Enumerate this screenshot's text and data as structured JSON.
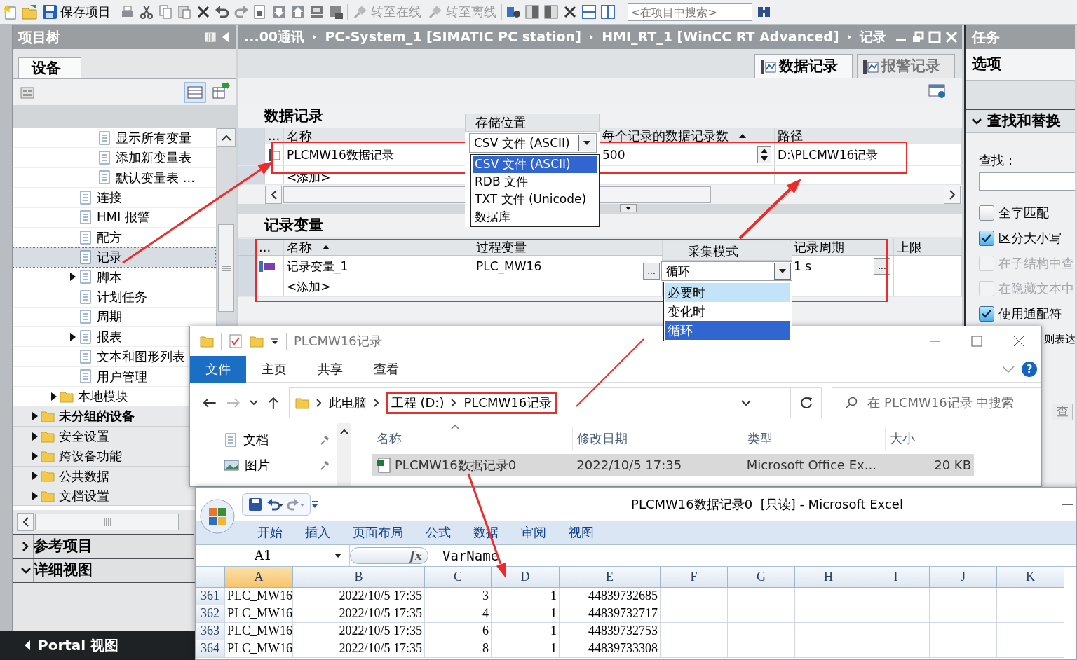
{
  "toolbar": {
    "save_label": "保存项目",
    "go_online": "转至在线",
    "go_offline": "转至离线",
    "search": {
      "placeholder": "<在项目中搜索>"
    }
  },
  "project_tree": {
    "title": "项目树",
    "tab": "设备",
    "items": [
      {
        "children": [
          {
            "children": [
              {
                "children": [
                  {
                    "label": "显示所有变量",
                    "collapsed": false,
                    "selected": false,
                    "bold": false
                  },
                  {
                    "label": "添加新变量表",
                    "collapsed": false,
                    "selected": false,
                    "bold": false
                  },
                  {
                    "label": "默认变量表 ...",
                    "collapsed": false,
                    "selected": false,
                    "bold": false
                  }
                ]
              },
              {
                "label": "连接",
                "collapsed": false,
                "selected": false,
                "bold": false
              },
              {
                "label": "HMI 报警",
                "collapsed": false,
                "selected": false,
                "bold": false
              },
              {
                "label": "配方",
                "collapsed": false,
                "selected": false,
                "bold": false
              },
              {
                "label": "记录",
                "collapsed": false,
                "selected": true,
                "bold": false
              },
              {
                "label": "脚本",
                "collapsed": true,
                "selected": false,
                "bold": false
              },
              {
                "label": "计划任务",
                "collapsed": false,
                "selected": false,
                "bold": false
              },
              {
                "label": "周期",
                "collapsed": false,
                "selected": false,
                "bold": false
              },
              {
                "label": "报表",
                "collapsed": true,
                "selected": false,
                "bold": false
              },
              {
                "label": "文本和图形列表",
                "collapsed": false,
                "selected": false,
                "bold": false
              },
              {
                "label": "用户管理",
                "collapsed": false,
                "selected": false,
                "bold": false
              }
            ]
          },
          {
            "label": "本地模块",
            "collapsed": true,
            "selected": false,
            "bold": false
          }
        ]
      },
      {
        "label": "未分组的设备",
        "collapsed": true,
        "selected": false,
        "bold": true
      },
      {
        "label": "安全设置",
        "collapsed": true,
        "selected": false,
        "bold": false
      },
      {
        "label": "跨设备功能",
        "collapsed": true,
        "selected": false,
        "bold": false
      },
      {
        "label": "公共数据",
        "collapsed": true,
        "selected": false,
        "bold": false
      },
      {
        "label": "文档设置",
        "collapsed": true,
        "selected": false,
        "bold": false
      }
    ]
  },
  "side_panels": [
    {
      "label": "参考项目",
      "expanded": false
    },
    {
      "label": "详细视图",
      "expanded": true
    }
  ],
  "portal_view": "Portal 视图",
  "editor": {
    "breadcrumb": [
      "...00通讯",
      "PC-System_1 [SIMATIC PC station]",
      "HMI_RT_1 [WinCC RT Advanced]",
      "记录"
    ],
    "tabs": [
      {
        "label": "数据记录",
        "selected": true
      },
      {
        "label": "报警记录",
        "selected": false
      }
    ],
    "data_logs": {
      "title": "数据记录",
      "columns": [
        {
          "label": "...",
          "sorted": false
        },
        {
          "label": "名称",
          "sorted": false
        },
        {
          "label": "每个记录的数据记录数",
          "sorted": true
        },
        {
          "label": "路径",
          "sorted": false
        }
      ],
      "rows": [
        {
          "name": "PLCMW16数据记录",
          "records_per_log": "500",
          "path": "D:\\PLCMW16记录"
        }
      ],
      "add_row": "<添加>"
    },
    "storage_popup": {
      "header": "存储位置",
      "value": "CSV 文件 (ASCII)",
      "options": [
        {
          "label": "CSV 文件 (ASCII)",
          "selected": true
        },
        {
          "label": "RDB 文件",
          "selected": false
        },
        {
          "label": "TXT 文件 (Unicode)",
          "selected": false
        },
        {
          "label": "数据库",
          "selected": false
        }
      ]
    },
    "logging_tags": {
      "title": "记录变量",
      "columns": [
        {
          "label": "...",
          "sorted": false
        },
        {
          "label": "名称",
          "sorted": true
        },
        {
          "label": "过程变量",
          "sorted": false
        },
        {
          "label": "记录周期",
          "sorted": false
        },
        {
          "label": "上限",
          "sorted": false
        }
      ],
      "rows": [
        {
          "name": "记录变量_1",
          "process_tag": "PLC_MW16",
          "cycle": "1 s",
          "browse_button": "..."
        }
      ],
      "add_row": "<添加>"
    },
    "mode_popup": {
      "header": "采集模式",
      "browse_button": "...",
      "value": "循环",
      "options": [
        {
          "label": "必要时",
          "selected": false,
          "hovered": true
        },
        {
          "label": "变化时",
          "selected": false,
          "hovered": false
        },
        {
          "label": "循环",
          "selected": true,
          "hovered": false
        }
      ]
    }
  },
  "tasks": {
    "title": "任务",
    "section": "选项",
    "find_replace": {
      "title": "查找和替换",
      "expanded": true,
      "find_label": "查找：",
      "options": [
        {
          "label": "全字匹配",
          "checked": false,
          "disabled": false
        },
        {
          "label": "区分大小写",
          "checked": true,
          "disabled": false
        },
        {
          "label": "在子结构中查",
          "checked": false,
          "disabled": true
        },
        {
          "label": "在隐藏文本中",
          "checked": false,
          "disabled": true
        },
        {
          "label": "使用通配符",
          "checked": true,
          "disabled": false
        }
      ],
      "partial_label": "则表达",
      "find_button": "查"
    }
  },
  "explorer": {
    "title": "PLCMW16记录",
    "ribbon_tabs": [
      {
        "label": "文件",
        "selected": true
      },
      {
        "label": "主页",
        "selected": false
      },
      {
        "label": "共享",
        "selected": false
      },
      {
        "label": "查看",
        "selected": false
      }
    ],
    "help_button": "?",
    "address": [
      "此电脑",
      "工程 (D:)",
      "PLCMW16记录"
    ],
    "search": {
      "placeholder": "在 PLCMW16记录 中搜索"
    },
    "nav_items": [
      {
        "label": "文档",
        "pinned": true
      },
      {
        "label": "图片",
        "pinned": true
      }
    ],
    "columns": [
      "名称",
      "修改日期",
      "类型",
      "大小"
    ],
    "files": [
      {
        "name": "PLCMW16数据记录0",
        "modified": "2022/10/5 17:35",
        "type": "Microsoft Office Ex...",
        "size": "20 KB",
        "selected": true
      }
    ]
  },
  "excel": {
    "title": "PLCMW16数据记录0  [只读] - Microsoft Excel",
    "ribbon_tabs": [
      "开始",
      "插入",
      "页面布局",
      "公式",
      "数据",
      "审阅",
      "视图"
    ],
    "name_box": "A1",
    "function_label": "fx",
    "formula": "VarName",
    "columns": [
      {
        "label": "A",
        "selected": true
      },
      {
        "label": "B",
        "selected": false
      },
      {
        "label": "C",
        "selected": false
      },
      {
        "label": "D",
        "selected": false
      },
      {
        "label": "E",
        "selected": false
      },
      {
        "label": "F",
        "selected": false
      },
      {
        "label": "G",
        "selected": false
      },
      {
        "label": "H",
        "selected": false
      },
      {
        "label": "I",
        "selected": false
      },
      {
        "label": "J",
        "selected": false
      },
      {
        "label": "K",
        "selected": false
      }
    ],
    "rows": [
      {
        "number": "361",
        "cells": [
          "PLC_MW16",
          "2022/10/5 17:35",
          "3",
          "1",
          "44839732685"
        ]
      },
      {
        "number": "362",
        "cells": [
          "PLC_MW16",
          "2022/10/5 17:35",
          "4",
          "1",
          "44839732717"
        ]
      },
      {
        "number": "363",
        "cells": [
          "PLC_MW16",
          "2022/10/5 17:35",
          "6",
          "1",
          "44839732753"
        ]
      },
      {
        "number": "364",
        "cells": [
          "PLC_MW16",
          "2022/10/5 17:35",
          "8",
          "1",
          "44839733308"
        ]
      }
    ]
  }
}
